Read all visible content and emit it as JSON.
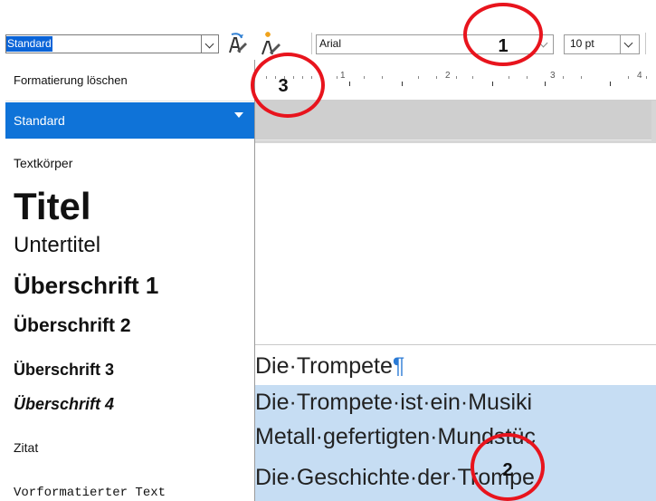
{
  "toolbar": {
    "paragraph_style_value": "Standard",
    "font_name_value": "Arial",
    "font_size_value": "10 pt",
    "update_style_icon": "update-style-icon",
    "new_style_icon": "new-style-icon"
  },
  "ruler": {
    "numbers": [
      "1",
      "2",
      "3",
      "4"
    ]
  },
  "style_list": {
    "clear_formatting": "Formatierung löschen",
    "items": [
      {
        "label": "Standard"
      },
      {
        "label": "Textkörper"
      },
      {
        "label": "Titel"
      },
      {
        "label": "Untertitel"
      },
      {
        "label": "Überschrift 1"
      },
      {
        "label": "Überschrift 2"
      },
      {
        "label": "Überschrift 3"
      },
      {
        "label": "Überschrift 4"
      },
      {
        "label": "Zitat"
      },
      {
        "label": "Vorformatierter Text"
      }
    ],
    "selected_index": 0
  },
  "document": {
    "heading_line": "Die·Trompete",
    "pilcrow": "¶",
    "body_lines": [
      "Die·Trompete·ist·ein·Musiki",
      "Metall·gefertigten·Mundstüc",
      "Die·Geschichte·der·Trompe"
    ]
  },
  "annotations": {
    "marker_1": "1",
    "marker_2": "2",
    "marker_3": "3",
    "color": "#e8141d"
  }
}
